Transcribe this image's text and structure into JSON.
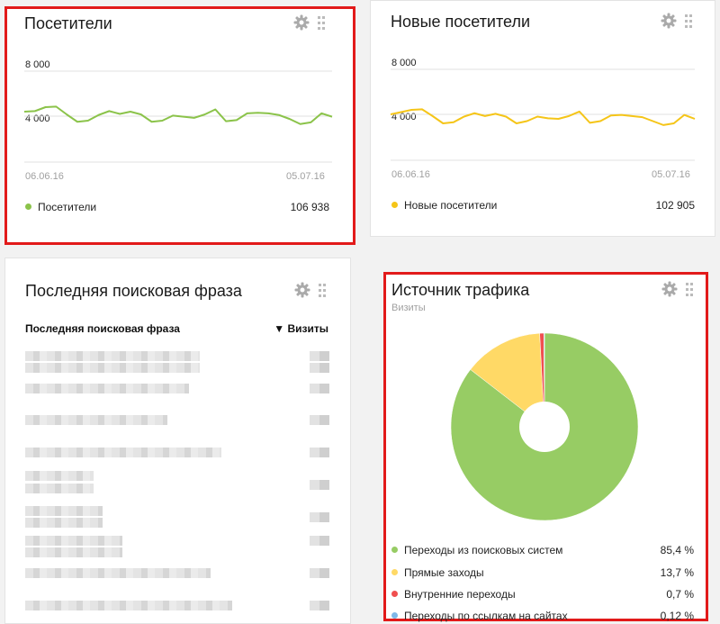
{
  "visitors": {
    "title": "Посетители",
    "y_ticks": [
      "8 000",
      "4 000"
    ],
    "date_start": "06.06.16",
    "date_end": "05.07.16",
    "legend_label": "Посетители",
    "total": "106 938",
    "color": "#8bc34a"
  },
  "new_visitors": {
    "title": "Новые посетители",
    "y_ticks": [
      "8 000",
      "4 000"
    ],
    "date_start": "06.06.16",
    "date_end": "05.07.16",
    "legend_label": "Новые посетители",
    "total": "102 905",
    "color": "#f5c518"
  },
  "search_phrase": {
    "title": "Последняя поисковая фраза",
    "col_phrase": "Последняя поисковая фраза",
    "col_visits": "▼ Визиты"
  },
  "traffic_source": {
    "title": "Источник трафика",
    "subtitle": "Визиты",
    "legend": [
      {
        "label": "Переходы из поисковых систем",
        "value": "85,4 %",
        "color": "#97cc64"
      },
      {
        "label": "Прямые заходы",
        "value": "13,7 %",
        "color": "#ffd966"
      },
      {
        "label": "Внутренние переходы",
        "value": "0,7 %",
        "color": "#f04f4f"
      },
      {
        "label": "Переходы по ссылкам на сайтах",
        "value": "0,12 %",
        "color": "#7fb8e8"
      }
    ]
  },
  "chart_data": [
    {
      "type": "line",
      "series": [
        {
          "name": "Посетители",
          "values": [
            4400,
            4450,
            4800,
            4850,
            4150,
            3500,
            3600,
            4100,
            4450,
            4200,
            4400,
            4150,
            3500,
            3600,
            4050,
            3950,
            3850,
            4150,
            4600,
            3550,
            3650,
            4250,
            4300,
            4250,
            4100,
            3750,
            3300,
            3450,
            4250,
            3950
          ]
        }
      ],
      "ylim": [
        0,
        10000
      ],
      "x_range": [
        "06.06.16",
        "05.07.16"
      ]
    },
    {
      "type": "line",
      "series": [
        {
          "name": "Новые посетители",
          "values": [
            4000,
            4200,
            4400,
            4450,
            3850,
            3200,
            3300,
            3800,
            4100,
            3850,
            4050,
            3800,
            3200,
            3400,
            3800,
            3650,
            3600,
            3850,
            4250,
            3250,
            3400,
            3900,
            3950,
            3850,
            3750,
            3400,
            3050,
            3200,
            3950,
            3600
          ]
        }
      ],
      "ylim": [
        0,
        10000
      ],
      "x_range": [
        "06.06.16",
        "05.07.16"
      ]
    },
    {
      "type": "pie",
      "categories": [
        "Переходы из поисковых систем",
        "Прямые заходы",
        "Внутренние переходы",
        "Переходы по ссылкам на сайтах"
      ],
      "values": [
        85.4,
        13.7,
        0.7,
        0.12
      ]
    }
  ]
}
